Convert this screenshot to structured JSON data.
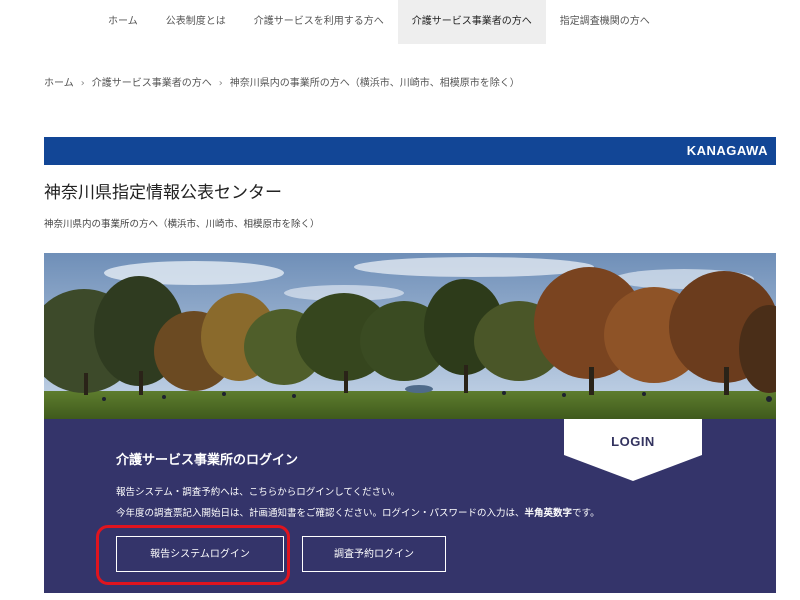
{
  "nav": {
    "items": [
      {
        "label": "ホーム"
      },
      {
        "label": "公表制度とは"
      },
      {
        "label": "介護サービスを利用する方へ"
      },
      {
        "label": "介護サービス事業者の方へ"
      },
      {
        "label": "指定調査機関の方へ"
      }
    ],
    "active_index": 3
  },
  "breadcrumb": {
    "items": [
      "ホーム",
      "介護サービス事業者の方へ",
      "神奈川県内の事業所の方へ（横浜市、川崎市、相模原市を除く）"
    ],
    "separator": "›"
  },
  "banner": {
    "label": "KANAGAWA",
    "color": "#124696"
  },
  "page": {
    "title": "神奈川県指定情報公表センター",
    "subtitle": "神奈川県内の事業所の方へ（横浜市、川崎市、相模原市を除く）"
  },
  "login_panel": {
    "tab_label": "LOGIN",
    "heading": "介護サービス事業所のログイン",
    "line1": "報告システム・調査予約へは、こちらからログインしてください。",
    "line2_before": "今年度の調査票記入開始日は、計画通知書をご確認ください。ログイン・パスワードの入力は、",
    "line2_emphasis": "半角英数字",
    "line2_after": "です。",
    "report_button": "報告システムログイン",
    "survey_button": "調査予約ログイン",
    "background_color": "#34346a"
  },
  "annotation": {
    "highlight_color": "#e0141e"
  }
}
